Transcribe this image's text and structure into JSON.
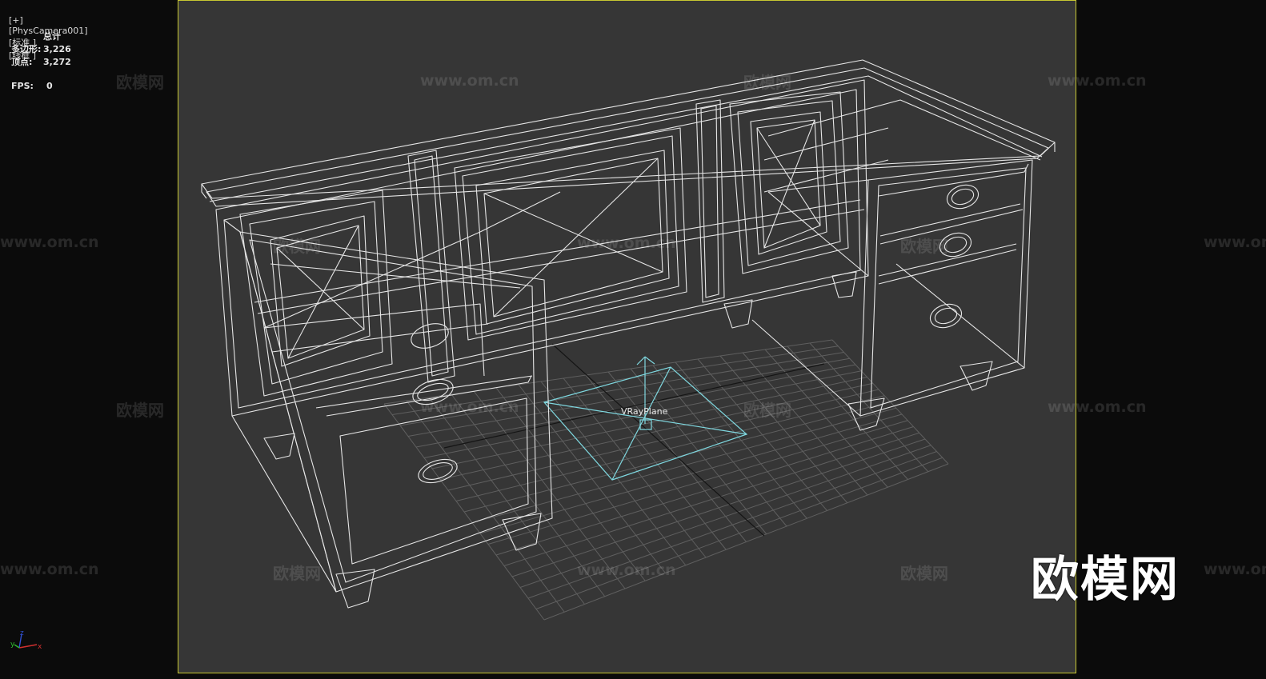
{
  "viewport": {
    "label_parts": [
      "[+]",
      "[PhysCamera001]",
      "[标准 ]",
      "[线框 ]"
    ]
  },
  "stats": {
    "header": "总计",
    "polygons_label": "多边形:",
    "polygons_value": "3,226",
    "vertices_label": "顶点:",
    "vertices_value": "3,272",
    "fps_label": "FPS:",
    "fps_value": "0"
  },
  "scene": {
    "object_label": "VRayPlane",
    "background_color": "#363636",
    "wire_color": "#e8e8e8",
    "vrayplane_color": "#7fd8e0",
    "grid_color": "#6a6a6a",
    "frame_color": "#c8c832"
  },
  "watermarks": {
    "brand_text": "欧模网",
    "url_text": "www.om.cn",
    "logo_text": "欧模网"
  },
  "axis_gizmo": {
    "x_label": "x",
    "y_label": "y",
    "z_label": "z"
  }
}
